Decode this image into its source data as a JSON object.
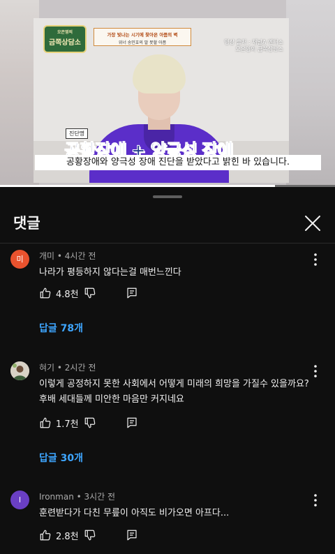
{
  "video": {
    "logo_text": "금쪽상담소",
    "logo_small": "오은영의",
    "top_caption_line1": "가장 빛나는 시기에 찾아온 아픔의 벽",
    "top_caption_line2": "위너 송민호의 말 못할 아픔",
    "source_note_line1": "영상 출처 : 채널A 엔터소",
    "source_note_line2": "오은영의 금쪽상담소",
    "badge_label": "진단명",
    "diagnosis_caption": "공황장애 + 양극성 장애",
    "subtitle": "공황장애와 양극성 장애 진단을 받았다고 밝힌 바 있습니다.",
    "progress_fraction": 0.82
  },
  "sheet": {
    "title": "댓글"
  },
  "comments": [
    {
      "avatar_text": "미",
      "avatar_color": "#e8522e",
      "meta": "개미 • 4시간 전",
      "lines": [
        "나라가 평등하지 않다는걸 매번느낀다"
      ],
      "likes": "4.8천",
      "replies": "답글 78개"
    },
    {
      "avatar_text": "",
      "avatar_color": "#d8d2c6",
      "meta": "혀기 • 2시간 전",
      "lines": [
        "이렇게 공정하지 못한 사회에서 어떻게 미래의 희망을 가질수 있을까요?",
        "후배 세대들께 미안한 마음만 커지네요"
      ],
      "likes": "1.7천",
      "replies": "답글 30개"
    },
    {
      "avatar_text": "I",
      "avatar_color": "#6a3fc4",
      "meta": "Ironman • 3시간 전",
      "lines": [
        "훈련받다가 다친 무릎이 아직도 비가오면 아프다..."
      ],
      "likes": "2.8천"
    }
  ]
}
